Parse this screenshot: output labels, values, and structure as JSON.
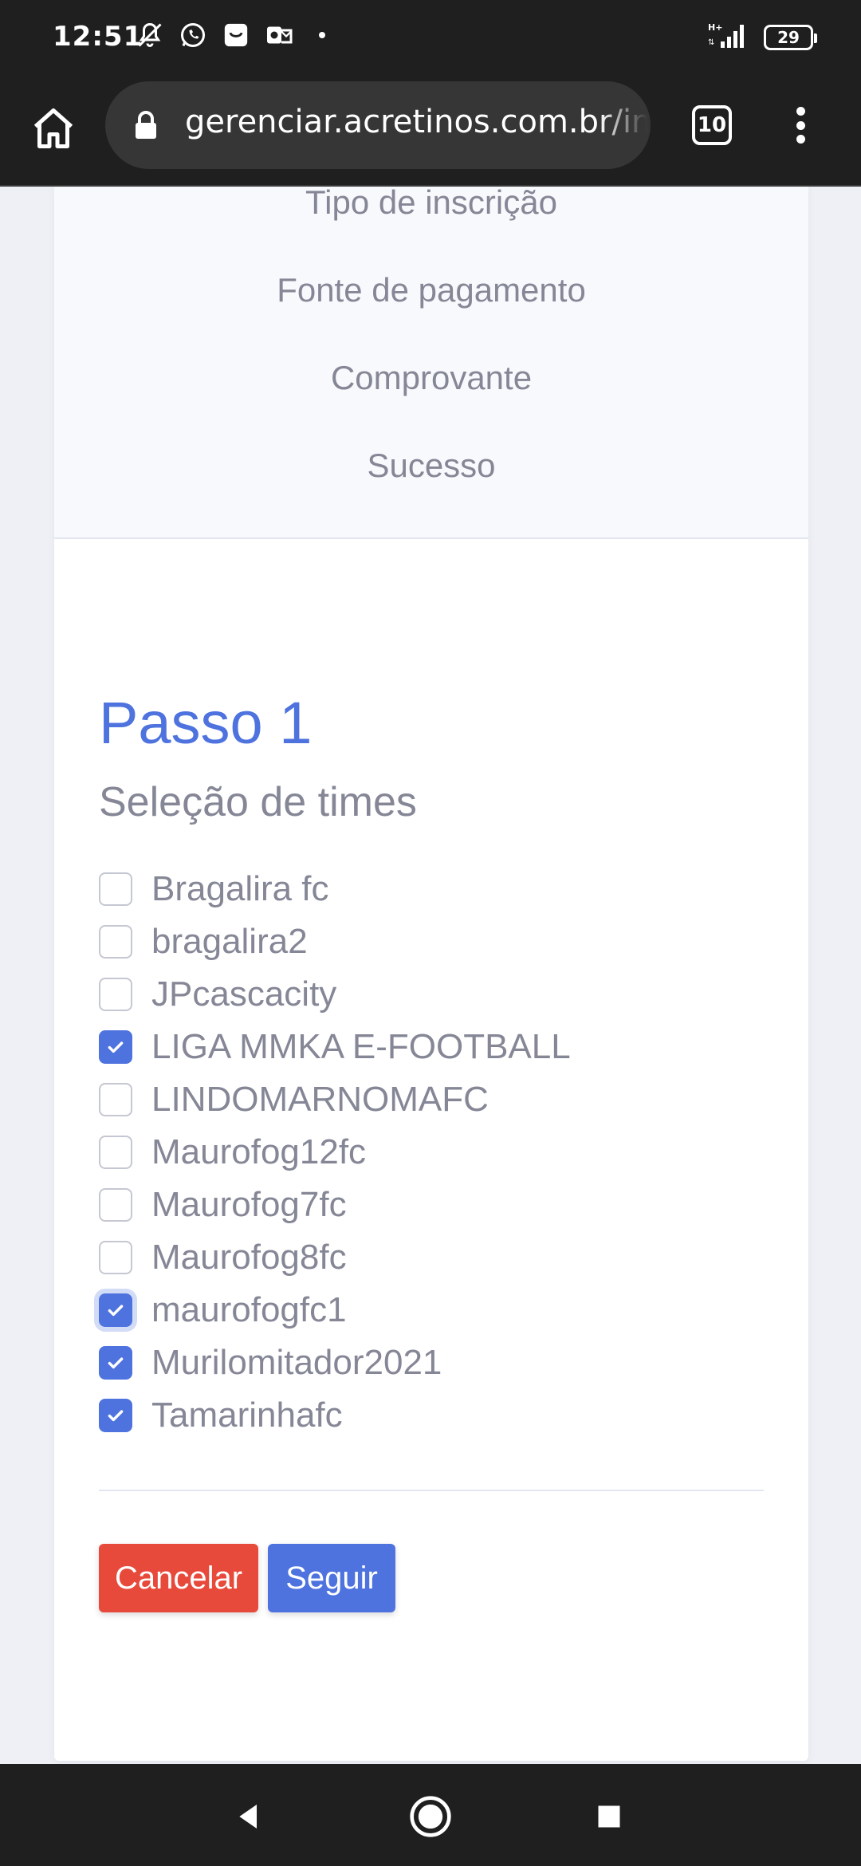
{
  "status_bar": {
    "time": "12:51",
    "battery": "29",
    "icons_left": [
      "mute-icon",
      "whatsapp-icon",
      "shopping-icon",
      "outlook-icon",
      "dot-icon"
    ],
    "icons_right": [
      "signal-icon",
      "battery-icon"
    ]
  },
  "browser": {
    "url": "gerenciar.acretinos.com.br/in",
    "tab_count": "10"
  },
  "steps": [
    "Tipo de inscrição",
    "Fonte de pagamento",
    "Comprovante",
    "Sucesso"
  ],
  "form": {
    "title": "Passo 1",
    "subtitle": "Seleção de times",
    "teams": [
      {
        "label": "Bragalira fc",
        "checked": false
      },
      {
        "label": "bragalira2",
        "checked": false
      },
      {
        "label": "JPcascacity",
        "checked": false
      },
      {
        "label": "LIGA MMKA E-FOOTBALL",
        "checked": true
      },
      {
        "label": "LINDOMARNOMAFC",
        "checked": false
      },
      {
        "label": "Maurofog12fc",
        "checked": false
      },
      {
        "label": "Maurofog7fc",
        "checked": false
      },
      {
        "label": "Maurofog8fc",
        "checked": false
      },
      {
        "label": "maurofogfc1",
        "checked": true,
        "focused": true
      },
      {
        "label": "Murilomitador2021",
        "checked": true
      },
      {
        "label": "Tamarinhafc",
        "checked": true
      }
    ],
    "cancel_label": "Cancelar",
    "next_label": "Seguir"
  },
  "colors": {
    "primary": "#4e73df",
    "danger": "#e74a3b",
    "muted_text": "#858796"
  }
}
